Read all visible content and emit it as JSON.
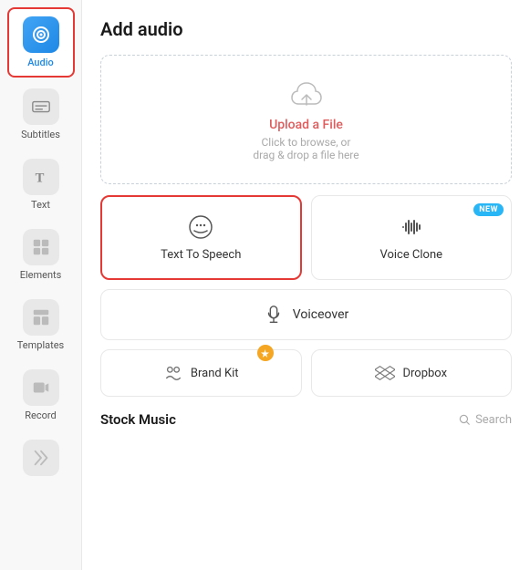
{
  "sidebar": {
    "items": [
      {
        "id": "audio",
        "label": "Audio",
        "active": true
      },
      {
        "id": "subtitles",
        "label": "Subtitles",
        "active": false
      },
      {
        "id": "text",
        "label": "Text",
        "active": false
      },
      {
        "id": "elements",
        "label": "Elements",
        "active": false
      },
      {
        "id": "templates",
        "label": "Templates",
        "active": false
      },
      {
        "id": "record",
        "label": "Record",
        "active": false
      },
      {
        "id": "more",
        "label": "",
        "active": false
      }
    ]
  },
  "main": {
    "page_title": "Add audio",
    "upload": {
      "title": "Upload a File",
      "subtitle": "Click to browse, or\ndrag & drop a file here"
    },
    "options": [
      {
        "id": "text-to-speech",
        "label": "Text To Speech",
        "active": true,
        "new": false
      },
      {
        "id": "voice-clone",
        "label": "Voice Clone",
        "active": false,
        "new": true
      }
    ],
    "voiceover": {
      "label": "Voiceover"
    },
    "brand_options": [
      {
        "id": "brand-kit",
        "label": "Brand Kit",
        "has_badge": true
      },
      {
        "id": "dropbox",
        "label": "Dropbox",
        "has_badge": false
      }
    ],
    "stock_music": {
      "title": "Stock Music",
      "search_label": "Search"
    }
  }
}
